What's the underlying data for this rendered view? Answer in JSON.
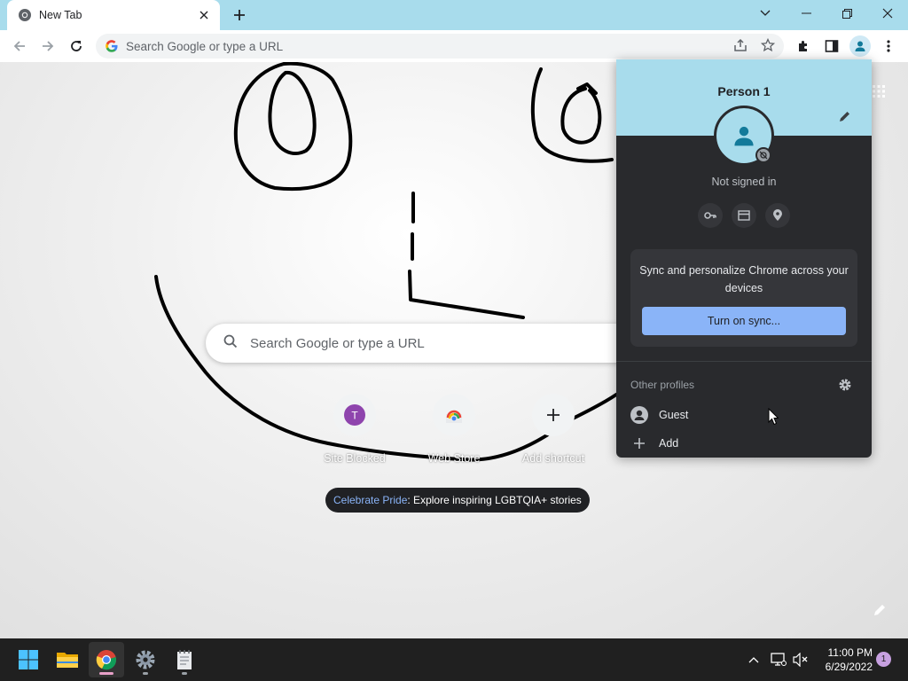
{
  "tab": {
    "title": "New Tab"
  },
  "omnibox": {
    "placeholder": "Search Google or type a URL"
  },
  "ntp": {
    "search_placeholder": "Search Google or type a URL",
    "shortcuts": [
      {
        "label": "Site Blocked",
        "letter": "T"
      },
      {
        "label": "Web Store"
      },
      {
        "label": "Add shortcut"
      }
    ],
    "promo": {
      "link_text": "Celebrate Pride",
      "rest_text": ": Explore inspiring LGBTQIA+ stories"
    }
  },
  "profile_menu": {
    "name": "Person 1",
    "status": "Not signed in",
    "sync_message": "Sync and personalize Chrome across your devices",
    "sync_button": "Turn on sync...",
    "other_profiles_label": "Other profiles",
    "profiles": [
      {
        "label": "Guest"
      },
      {
        "label": "Add"
      }
    ]
  },
  "taskbar": {
    "time": "11:00 PM",
    "date": "6/29/2022",
    "notification_count": "1"
  },
  "colors": {
    "tabbar": "#a8dcec",
    "popup_bg": "#292a2d",
    "sync_button": "#8ab4f8",
    "taskbar": "#202020"
  }
}
